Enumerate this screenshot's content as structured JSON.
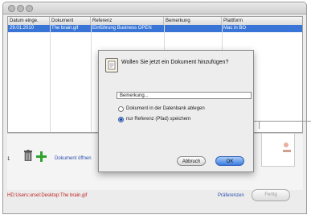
{
  "table": {
    "headers": [
      "Datum einge.",
      "Dokument",
      "Referenz",
      "Bemerkung",
      "Plattform"
    ],
    "rows": [
      {
        "date": "29.01.2010",
        "doc": "The brain.gif",
        "ref": "Einführung Business OPEN",
        "remark": "",
        "platform": "Mac in BO"
      }
    ]
  },
  "bottom": {
    "count": "1",
    "doc_link": "Dokument öffnen",
    "path": "HD:Users:ursel:Desktop:The brain.gif",
    "preferences": "Präferenzen",
    "done": "Fertig"
  },
  "dialog": {
    "question": "Wollen Sie jetzt ein Dokument hinzufügen?",
    "remark_value": "Bemerkung...",
    "option1": "Dokument in der Datenbank ablegen",
    "option2": "nur Referenz (Pfad) speichern",
    "selected": "option2",
    "cancel": "Abbruch",
    "ok": "OK"
  },
  "colors": {
    "selection": "#3875d7",
    "path": "#c02020",
    "link": "#2a4fb0",
    "ok_button": "#3a7be0"
  }
}
